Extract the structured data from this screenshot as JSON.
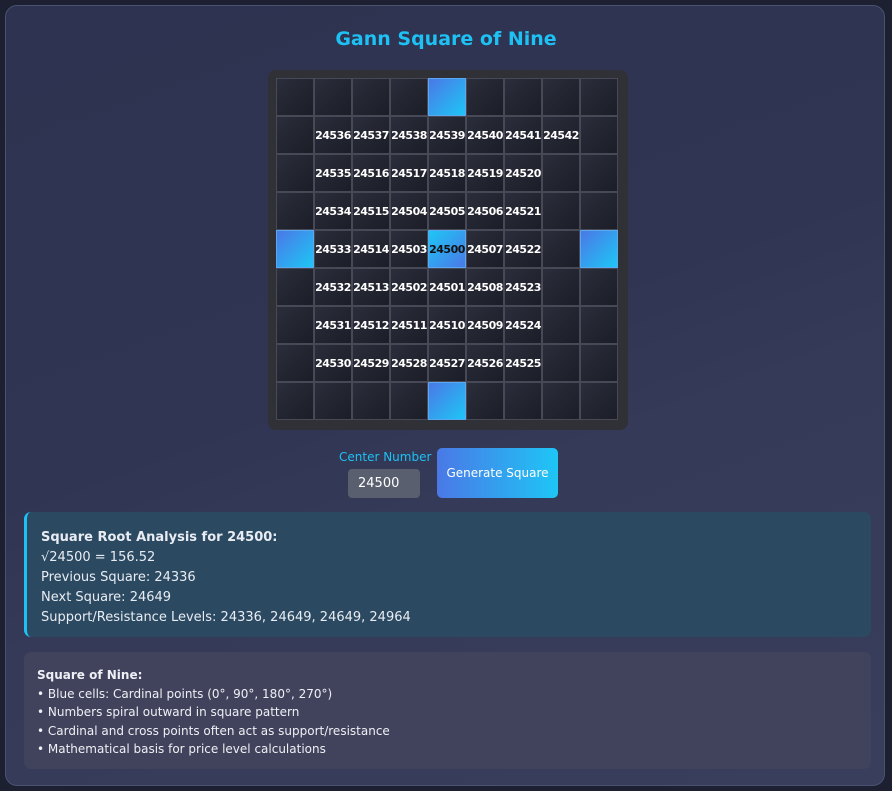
{
  "title": "Gann Square of Nine",
  "grid": {
    "rows": [
      [
        {
          "v": "",
          "t": "empty"
        },
        {
          "v": "",
          "t": "empty"
        },
        {
          "v": "",
          "t": "empty"
        },
        {
          "v": "",
          "t": "empty"
        },
        {
          "v": "",
          "t": "cardinal"
        },
        {
          "v": "",
          "t": "empty"
        },
        {
          "v": "",
          "t": "empty"
        },
        {
          "v": "",
          "t": "empty"
        },
        {
          "v": "",
          "t": "empty"
        }
      ],
      [
        {
          "v": "",
          "t": "empty"
        },
        {
          "v": "24536",
          "t": "num"
        },
        {
          "v": "24537",
          "t": "num"
        },
        {
          "v": "24538",
          "t": "num"
        },
        {
          "v": "24539",
          "t": "num"
        },
        {
          "v": "24540",
          "t": "num"
        },
        {
          "v": "24541",
          "t": "num"
        },
        {
          "v": "24542",
          "t": "num"
        },
        {
          "v": "",
          "t": "empty"
        }
      ],
      [
        {
          "v": "",
          "t": "empty"
        },
        {
          "v": "24535",
          "t": "num"
        },
        {
          "v": "24516",
          "t": "num"
        },
        {
          "v": "24517",
          "t": "num"
        },
        {
          "v": "24518",
          "t": "num"
        },
        {
          "v": "24519",
          "t": "num"
        },
        {
          "v": "24520",
          "t": "num"
        },
        {
          "v": "",
          "t": "empty"
        },
        {
          "v": "",
          "t": "empty"
        }
      ],
      [
        {
          "v": "",
          "t": "empty"
        },
        {
          "v": "24534",
          "t": "num"
        },
        {
          "v": "24515",
          "t": "num"
        },
        {
          "v": "24504",
          "t": "num"
        },
        {
          "v": "24505",
          "t": "num"
        },
        {
          "v": "24506",
          "t": "num"
        },
        {
          "v": "24521",
          "t": "num"
        },
        {
          "v": "",
          "t": "empty"
        },
        {
          "v": "",
          "t": "empty"
        }
      ],
      [
        {
          "v": "",
          "t": "cardinal"
        },
        {
          "v": "24533",
          "t": "num"
        },
        {
          "v": "24514",
          "t": "num"
        },
        {
          "v": "24503",
          "t": "num"
        },
        {
          "v": "24500",
          "t": "center"
        },
        {
          "v": "24507",
          "t": "num"
        },
        {
          "v": "24522",
          "t": "num"
        },
        {
          "v": "",
          "t": "empty"
        },
        {
          "v": "",
          "t": "cardinal"
        }
      ],
      [
        {
          "v": "",
          "t": "empty"
        },
        {
          "v": "24532",
          "t": "num"
        },
        {
          "v": "24513",
          "t": "num"
        },
        {
          "v": "24502",
          "t": "num"
        },
        {
          "v": "24501",
          "t": "num"
        },
        {
          "v": "24508",
          "t": "num"
        },
        {
          "v": "24523",
          "t": "num"
        },
        {
          "v": "",
          "t": "empty"
        },
        {
          "v": "",
          "t": "empty"
        }
      ],
      [
        {
          "v": "",
          "t": "empty"
        },
        {
          "v": "24531",
          "t": "num"
        },
        {
          "v": "24512",
          "t": "num"
        },
        {
          "v": "24511",
          "t": "num"
        },
        {
          "v": "24510",
          "t": "num"
        },
        {
          "v": "24509",
          "t": "num"
        },
        {
          "v": "24524",
          "t": "num"
        },
        {
          "v": "",
          "t": "empty"
        },
        {
          "v": "",
          "t": "empty"
        }
      ],
      [
        {
          "v": "",
          "t": "empty"
        },
        {
          "v": "24530",
          "t": "num"
        },
        {
          "v": "24529",
          "t": "num"
        },
        {
          "v": "24528",
          "t": "num"
        },
        {
          "v": "24527",
          "t": "num"
        },
        {
          "v": "24526",
          "t": "num"
        },
        {
          "v": "24525",
          "t": "num"
        },
        {
          "v": "",
          "t": "empty"
        },
        {
          "v": "",
          "t": "empty"
        }
      ],
      [
        {
          "v": "",
          "t": "empty"
        },
        {
          "v": "",
          "t": "empty"
        },
        {
          "v": "",
          "t": "empty"
        },
        {
          "v": "",
          "t": "empty"
        },
        {
          "v": "",
          "t": "cardinal"
        },
        {
          "v": "",
          "t": "empty"
        },
        {
          "v": "",
          "t": "empty"
        },
        {
          "v": "",
          "t": "empty"
        },
        {
          "v": "",
          "t": "empty"
        }
      ]
    ]
  },
  "controls": {
    "center_label": "Center Number",
    "center_value": "24500",
    "generate_label": "Generate Square"
  },
  "analysis": {
    "heading": "Square Root Analysis for 24500:",
    "sqrt_line": "√24500 = 156.52",
    "previous": "Previous Square: 24336",
    "next": "Next Square: 24649",
    "levels": "Support/Resistance Levels: 24336, 24649, 24649, 24964"
  },
  "notes": {
    "heading": "Square of Nine:",
    "items": [
      "• Blue cells: Cardinal points (0°, 90°, 180°, 270°)",
      "• Numbers spiral outward in square pattern",
      "• Cardinal and cross points often act as support/resistance",
      "• Mathematical basis for price level calculations"
    ]
  }
}
